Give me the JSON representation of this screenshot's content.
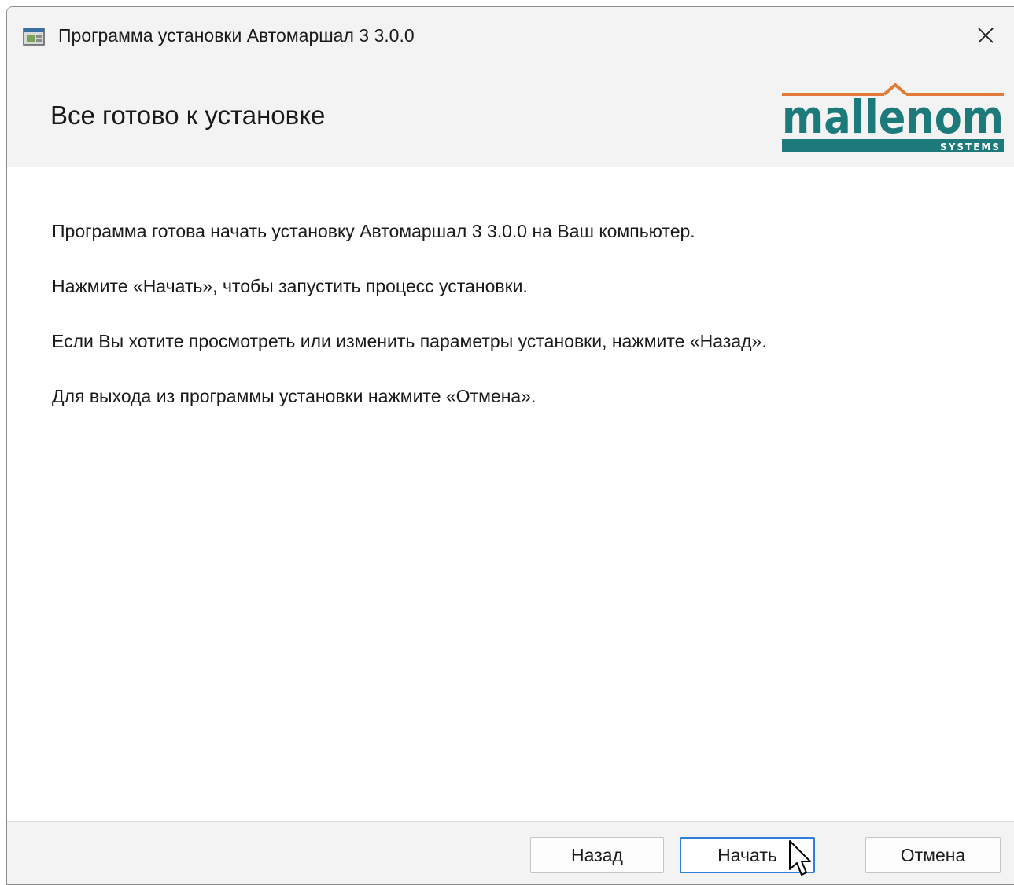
{
  "window": {
    "title": "Программа установки Автомаршал 3 3.0.0",
    "close_symbol": "✕"
  },
  "header": {
    "title": "Все готово к установке",
    "logo": {
      "wordmark": "mallenom",
      "tagline": "SYSTEMS",
      "colors": {
        "teal": "#1c7a7a",
        "orange": "#e07b3c"
      }
    }
  },
  "content": {
    "paragraphs": [
      "Программа готова начать установку Автомаршал 3 3.0.0 на Ваш компьютер.",
      "Нажмите «Начать», чтобы запустить процесс установки.",
      "Если Вы хотите просмотреть или изменить параметры установки, нажмите «Назад».",
      "Для выхода из программы установки нажмите «Отмена»."
    ]
  },
  "footer": {
    "back_label": "Назад",
    "start_label": "Начать",
    "cancel_label": "Отмена"
  },
  "icons": {
    "app": "installer-app-icon",
    "close": "close-icon",
    "cursor": "mouse-pointer-icon"
  },
  "colors": {
    "titlebar_bg": "#f3f3f3",
    "focus_border": "#2f7fd6"
  }
}
